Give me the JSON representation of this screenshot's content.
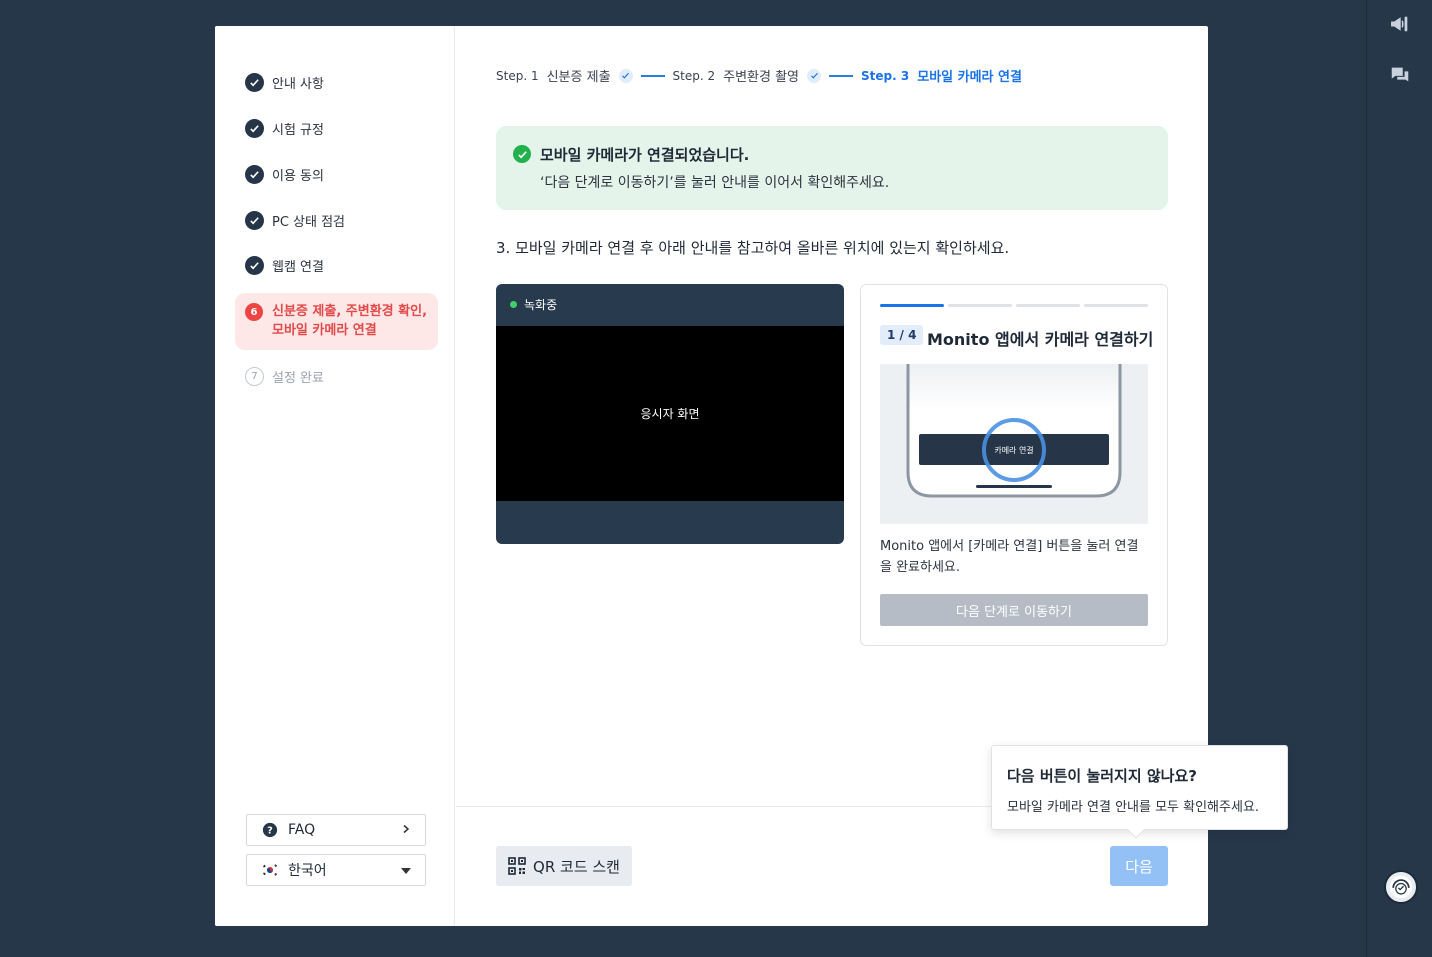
{
  "sidebar": {
    "completed_items": [
      {
        "label": "안내 사항"
      },
      {
        "label": "시험 규정"
      },
      {
        "label": "이용 동의"
      },
      {
        "label": "PC 상태 점검"
      },
      {
        "label": "웹캠 연결"
      }
    ],
    "active_item": {
      "number": "6",
      "label": "신분증 제출, 주변환경 확인, 모바일 카메라 연결"
    },
    "pending_item": {
      "number": "7",
      "label": "설정 완료"
    },
    "faq_label": "FAQ",
    "language_label": "한국어"
  },
  "stepper": {
    "steps": [
      {
        "step_label": "Step. 1",
        "title": "신분증 제출"
      },
      {
        "step_label": "Step. 2",
        "title": "주변환경 촬영"
      },
      {
        "step_label": "Step. 3",
        "title": "모바일 카메라 연결"
      }
    ]
  },
  "success": {
    "title": "모바일 카메라가 연결되었습니다.",
    "message": "‘다음 단계로 이동하기’를 눌러 안내를 이어서 확인해주세요."
  },
  "instruction": "3. 모바일 카메라 연결 후 아래 안내를 참고하여 올바른 위치에 있는지 확인하세요.",
  "video": {
    "status": "녹화중",
    "screen_label": "응시자 화면"
  },
  "guide": {
    "progress": {
      "current": 1,
      "total": 4
    },
    "badge": "1 / 4",
    "title": "Monito 앱에서 카메라 연결하기",
    "illustration_button": "카메라 연결",
    "description": "Monito 앱에서 [카메라 연결] 버튼을 눌러 연결을 완료하세요.",
    "next_step_label": "다음 단계로 이동하기"
  },
  "footer": {
    "qr_label": "QR 코드 스캔",
    "next_label": "다음"
  },
  "tooltip": {
    "title": "다음 버튼이 눌러지지 않나요?",
    "message": "모바일 카메라 연결 안내를 모두 확인해주세요."
  },
  "colors": {
    "background": "#27374a",
    "accent": "#1a73e8",
    "active_red": "#e24a4a",
    "success_green": "#22b14c"
  },
  "icons": {
    "rail_top": "megaphone-icon",
    "rail_second": "chat-icon",
    "support": "headset-avatar-icon"
  }
}
